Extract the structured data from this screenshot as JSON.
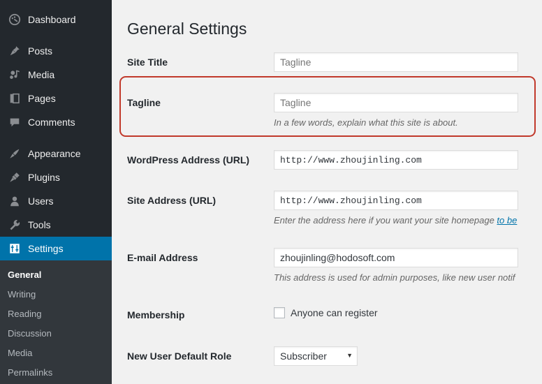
{
  "sidebar": {
    "primary": [
      {
        "label": "Dashboard",
        "icon": "dashboard-icon",
        "current": false
      },
      {
        "label": "Posts",
        "icon": "pin-icon",
        "current": false
      },
      {
        "label": "Media",
        "icon": "media-icon",
        "current": false
      },
      {
        "label": "Pages",
        "icon": "page-icon",
        "current": false
      },
      {
        "label": "Comments",
        "icon": "comment-icon",
        "current": false
      },
      {
        "label": "Appearance",
        "icon": "paintbrush-icon",
        "current": false
      },
      {
        "label": "Plugins",
        "icon": "plug-icon",
        "current": false
      },
      {
        "label": "Users",
        "icon": "user-icon",
        "current": false
      },
      {
        "label": "Tools",
        "icon": "wrench-icon",
        "current": false
      },
      {
        "label": "Settings",
        "icon": "settings-icon",
        "current": true
      }
    ],
    "submenu": [
      {
        "label": "General",
        "current": true
      },
      {
        "label": "Writing",
        "current": false
      },
      {
        "label": "Reading",
        "current": false
      },
      {
        "label": "Discussion",
        "current": false
      },
      {
        "label": "Media",
        "current": false
      },
      {
        "label": "Permalinks",
        "current": false
      }
    ]
  },
  "main": {
    "page_title": "General Settings",
    "fields": {
      "site_title": {
        "label": "Site Title",
        "value": "",
        "placeholder": "Tagline"
      },
      "tagline": {
        "label": "Tagline",
        "value": "",
        "placeholder": "Tagline",
        "description": "In a few words, explain what this site is about.",
        "highlighted": true
      },
      "wordpress_address": {
        "label": "WordPress Address (URL)",
        "value": "http://www.zhoujinling.com"
      },
      "site_address": {
        "label": "Site Address (URL)",
        "value": "http://www.zhoujinling.com",
        "description_before": "Enter the address here if you want your site homepage ",
        "description_link": "to be",
        "description_after": ""
      },
      "email_address": {
        "label": "E-mail Address",
        "value": "zhoujinling@hodosoft.com",
        "description": "This address is used for admin purposes, like new user notif"
      },
      "membership": {
        "label": "Membership",
        "checkbox_label": "Anyone can register",
        "checked": false
      },
      "new_user_default_role": {
        "label": "New User Default Role",
        "value": "Subscriber"
      }
    }
  },
  "colors": {
    "sidebar_bg": "#23282d",
    "submenu_bg": "#32373c",
    "accent_blue": "#0073aa",
    "highlight_red": "#c1392b",
    "main_bg": "#f1f1f1"
  }
}
